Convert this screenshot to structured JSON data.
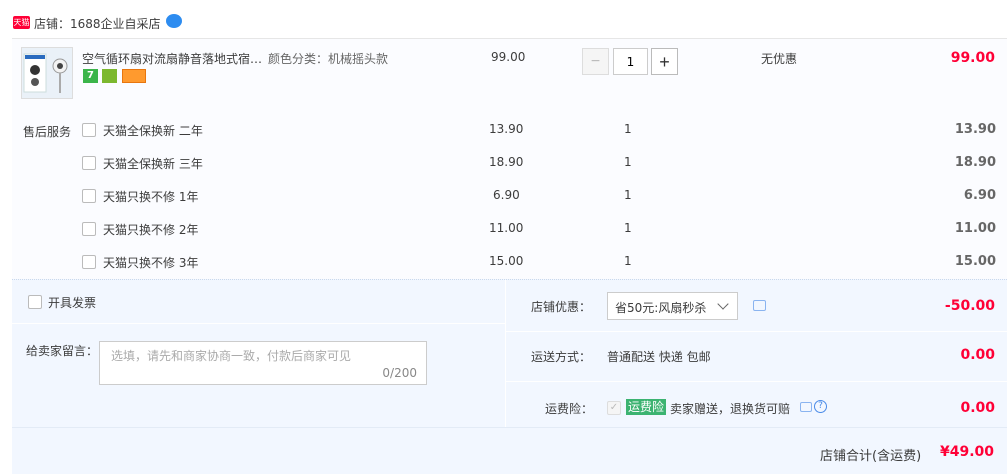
{
  "shop": {
    "badge": "天猫",
    "label": "店铺：",
    "name": "1688企业自采店",
    "im_icon": "chat-bubble-icon"
  },
  "item": {
    "title": "空气循环扇对流扇静音落地式宿…",
    "sku": "颜色分类：机械摇头款",
    "price": "99.00",
    "quantity": "1",
    "promo": "无优惠",
    "subtotal": "99.00",
    "badges": [
      "7-day-return-icon",
      "guarantee-icon",
      "card-icon"
    ]
  },
  "services": {
    "label": "售后服务",
    "items": [
      {
        "name": "天猫全保换新 二年",
        "price": "13.90",
        "qty": "1",
        "total": "13.90"
      },
      {
        "name": "天猫全保换新 三年",
        "price": "18.90",
        "qty": "1",
        "total": "18.90"
      },
      {
        "name": "天猫只换不修 1年",
        "price": "6.90",
        "qty": "1",
        "total": "6.90"
      },
      {
        "name": "天猫只换不修 2年",
        "price": "11.00",
        "qty": "1",
        "total": "11.00"
      },
      {
        "name": "天猫只换不修 3年",
        "price": "15.00",
        "qty": "1",
        "total": "15.00"
      }
    ]
  },
  "invoice": {
    "label": "开具发票"
  },
  "message": {
    "label": "给卖家留言：",
    "placeholder": "选填，请先和商家协商一致，付款后商家可见",
    "counter": "0/200"
  },
  "discount": {
    "label": "店铺优惠：",
    "selected": "省50元:风扇秒杀",
    "amount": "-50.00"
  },
  "shipping": {
    "label": "运送方式：",
    "method": "普通配送 快递 包邮",
    "amount": "0.00"
  },
  "insurance": {
    "label": "运费险：",
    "tag": "运费险",
    "desc": "卖家赠送，退换货可赔",
    "amount": "0.00"
  },
  "total": {
    "label": "店铺合计(含运费)",
    "amount": "¥49.00"
  },
  "colors": {
    "accent": "#ff0036",
    "row_bg": "#fbfcff",
    "footer_bg": "#f2f7ff",
    "tag_green": "#3cb371"
  }
}
